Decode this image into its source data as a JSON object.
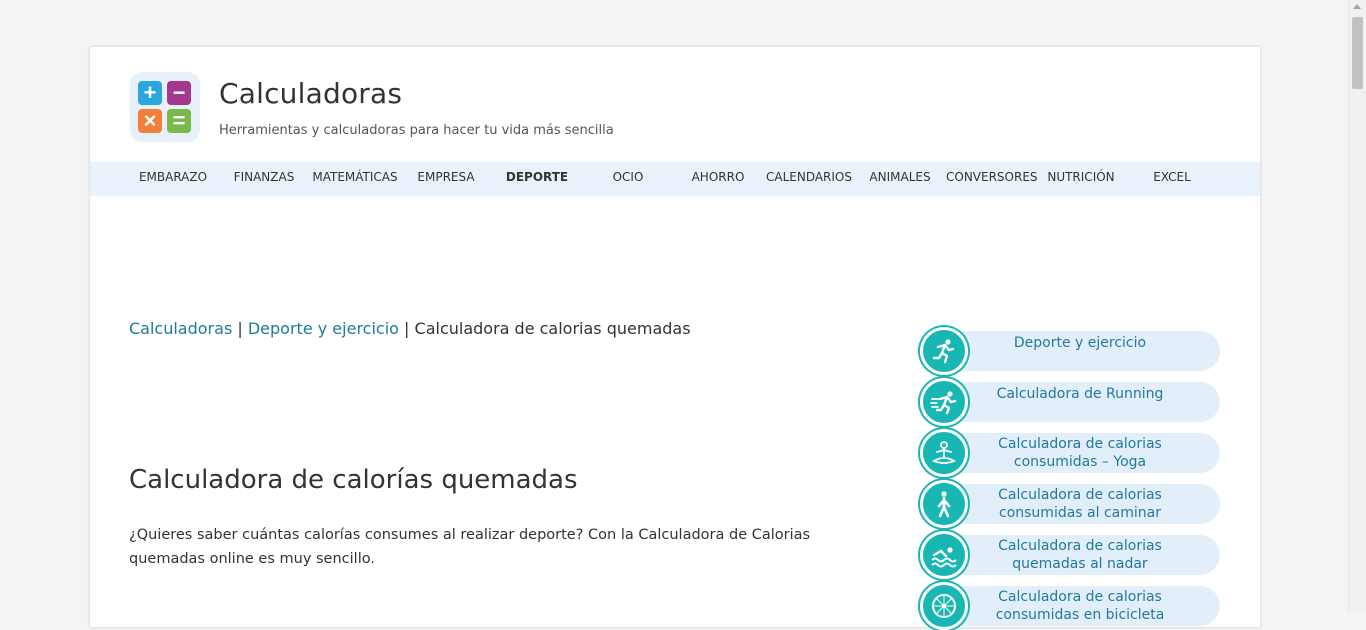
{
  "header": {
    "title": "Calculadoras",
    "tagline": "Herramientas y calculadoras para hacer tu vida más sencilla",
    "logo_colors": {
      "plus": "#2aa7df",
      "minus": "#a3388e",
      "times": "#f2803a",
      "equals": "#7bb84a"
    }
  },
  "nav": {
    "items": [
      {
        "label": "EMBARAZO"
      },
      {
        "label": "FINANZAS"
      },
      {
        "label": "MATEMÁTICAS"
      },
      {
        "label": "EMPRESA"
      },
      {
        "label": "DEPORTE",
        "active": true
      },
      {
        "label": "OCIO"
      },
      {
        "label": "AHORRO"
      },
      {
        "label": "CALENDARIOS"
      },
      {
        "label": "ANIMALES"
      },
      {
        "label": "CONVERSORES"
      },
      {
        "label": "NUTRICIÓN"
      },
      {
        "label": "EXCEL"
      }
    ]
  },
  "breadcrumb": {
    "home": "Calculadoras",
    "separator": "|",
    "category": "Deporte y ejercicio",
    "current": "Calculadora de calorias quemadas"
  },
  "content": {
    "heading": "Calculadora de calorías quemadas",
    "intro": "¿Quieres saber cuántas calorías consumes al realizar deporte? Con la Calculadora de Calorias quemadas online es muy sencillo."
  },
  "sidebar": {
    "items": [
      {
        "label": "Deporte y ejercicio",
        "icon": "runner-icon"
      },
      {
        "label": "Calculadora de Running",
        "icon": "sprinter-icon"
      },
      {
        "label": "Calculadora de calorias consumidas – Yoga",
        "icon": "yoga-icon"
      },
      {
        "label": "Calculadora de calorias consumidas al caminar",
        "icon": "walking-icon"
      },
      {
        "label": "Calculadora de calorias quemadas al nadar",
        "icon": "swimming-icon"
      },
      {
        "label": "Calculadora de calorias consumidas en bicicleta",
        "icon": "bicycle-wheel-icon"
      }
    ],
    "accent_color": "#19b7b3",
    "pill_color": "#e3eefb",
    "link_color": "#1f7a9c"
  }
}
